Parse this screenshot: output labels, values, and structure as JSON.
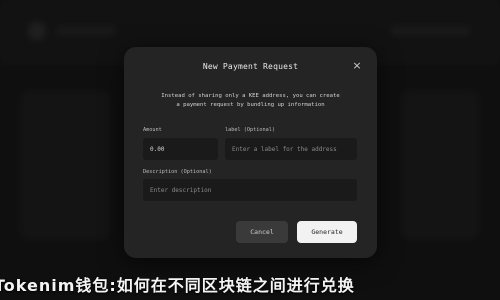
{
  "modal": {
    "title": "New Payment Request",
    "close_glyph": "×",
    "description_line1": "Instead of sharing only a KEE address, you can create",
    "description_line2": "a payment request by bundling up information",
    "amount": {
      "label": "Amount",
      "value": "0.00"
    },
    "label_field": {
      "label": "label (Optional)",
      "placeholder": "Enter a label for the address"
    },
    "description_field": {
      "label": "Description (Optional)",
      "placeholder": "Enter description"
    },
    "cancel_label": "Cancel",
    "generate_label": "Generate"
  },
  "footer": {
    "text": "Tokenim钱包:如何在不同区块链之间进行兑换"
  },
  "colors": {
    "modal_bg": "#242424",
    "input_bg": "#1a1a1a",
    "primary_button": "#f2f2f2"
  }
}
